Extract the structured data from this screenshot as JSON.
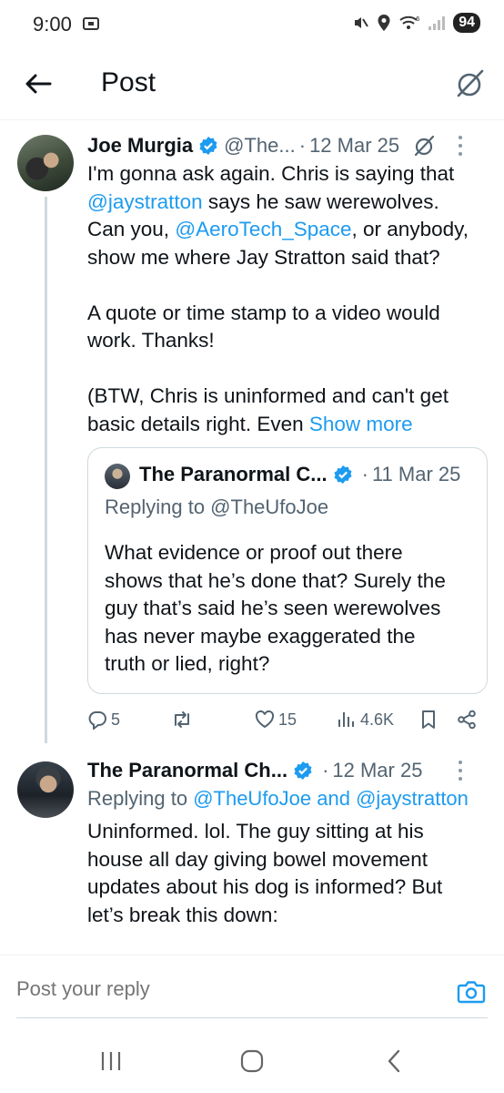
{
  "status_bar": {
    "time": "9:00",
    "battery": "94"
  },
  "header": {
    "title": "Post"
  },
  "main_post": {
    "display_name": "Joe Murgia",
    "handle": "@The...",
    "separator": "·",
    "date": "12 Mar 25",
    "text_lines": {
      "l1": "I'm gonna ask again. Chris is saying that",
      "l2_mention": "@jaystratton",
      "l2_rest": " says he saw werewolves.",
      "l3_pre": "Can you, ",
      "l3_mention": "@AeroTech_Space",
      "l3_rest": ", or anybody,",
      "l4": "show me where Jay Stratton said that?",
      "l5": "A quote or time stamp to a video would",
      "l6": "work. Thanks!",
      "l7": "(BTW, Chris is uninformed and can't get",
      "l8_pre": "basic details right. Even ",
      "l8_link": "Show more"
    },
    "quote": {
      "display_name": "The Paranormal C...",
      "separator": "·",
      "date": "11 Mar 25",
      "replying": "Replying to @TheUfoJoe",
      "lines": [
        "What evidence or proof out there",
        "shows that he’s done that? Surely the",
        "guy that’s said he’s seen werewolves",
        "has never maybe exaggerated the",
        "truth or lied, right?"
      ]
    },
    "actions": {
      "replies": "5",
      "reposts": "",
      "likes": "15",
      "views": "4.6K"
    }
  },
  "reply_post": {
    "display_name": "The Paranormal Ch...",
    "separator": "·",
    "date": "12 Mar 25",
    "replying_pre": "Replying to ",
    "replying_mention1": "@TheUfoJoe",
    "replying_and": " and ",
    "replying_mention2": "@jaystratton",
    "lines": [
      "Uninformed. lol. The guy sitting at his",
      "house all day giving bowel movement",
      "updates about his dog is informed? But",
      "let’s break this down:"
    ]
  },
  "compose": {
    "placeholder": "Post your reply"
  },
  "colors": {
    "accent": "#1d9bf0",
    "secondary_text": "#536471",
    "primary_text": "#0f1419",
    "border": "#cfd9de"
  }
}
